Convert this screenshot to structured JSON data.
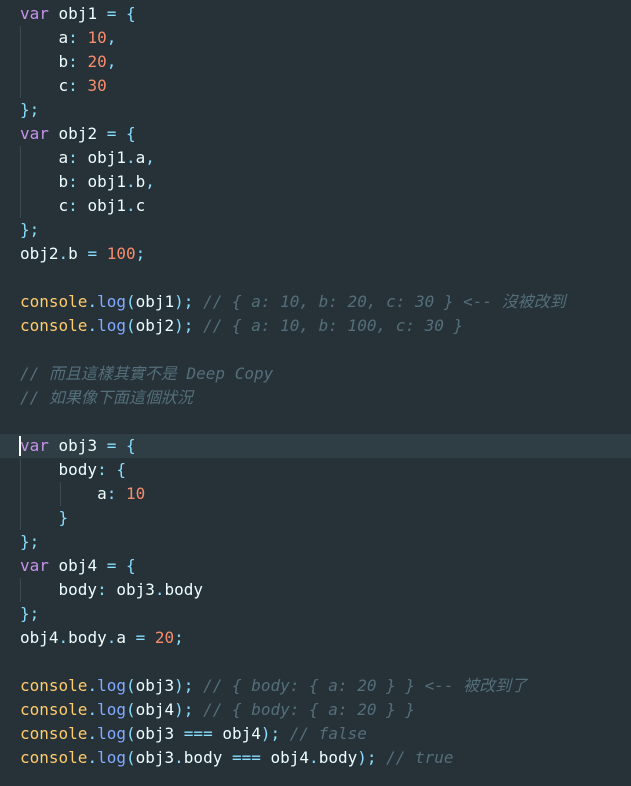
{
  "editor": {
    "colors": {
      "background": "#263238",
      "current_line": "#2f3d44",
      "keyword": "#c792ea",
      "variable": "#eeffff",
      "punctuation": "#89ddff",
      "number": "#f78c6c",
      "console": "#ffcb6b",
      "function": "#82aaff",
      "comment": "#546e7a"
    },
    "current_line": 18,
    "lines": [
      [
        [
          "kw",
          "var"
        ],
        [
          "var",
          " obj1 "
        ],
        [
          "punc",
          "="
        ],
        [
          "var",
          " "
        ],
        [
          "punc",
          "{"
        ]
      ],
      [
        [
          "var",
          "    a"
        ],
        [
          "punc",
          ":"
        ],
        [
          "var",
          " "
        ],
        [
          "num",
          "10"
        ],
        [
          "punc",
          ","
        ]
      ],
      [
        [
          "var",
          "    b"
        ],
        [
          "punc",
          ":"
        ],
        [
          "var",
          " "
        ],
        [
          "num",
          "20"
        ],
        [
          "punc",
          ","
        ]
      ],
      [
        [
          "var",
          "    c"
        ],
        [
          "punc",
          ":"
        ],
        [
          "var",
          " "
        ],
        [
          "num",
          "30"
        ]
      ],
      [
        [
          "punc",
          "};"
        ]
      ],
      [
        [
          "kw",
          "var"
        ],
        [
          "var",
          " obj2 "
        ],
        [
          "punc",
          "="
        ],
        [
          "var",
          " "
        ],
        [
          "punc",
          "{"
        ]
      ],
      [
        [
          "var",
          "    a"
        ],
        [
          "punc",
          ":"
        ],
        [
          "var",
          " obj1"
        ],
        [
          "punc",
          "."
        ],
        [
          "var",
          "a"
        ],
        [
          "punc",
          ","
        ]
      ],
      [
        [
          "var",
          "    b"
        ],
        [
          "punc",
          ":"
        ],
        [
          "var",
          " obj1"
        ],
        [
          "punc",
          "."
        ],
        [
          "var",
          "b"
        ],
        [
          "punc",
          ","
        ]
      ],
      [
        [
          "var",
          "    c"
        ],
        [
          "punc",
          ":"
        ],
        [
          "var",
          " obj1"
        ],
        [
          "punc",
          "."
        ],
        [
          "var",
          "c"
        ]
      ],
      [
        [
          "punc",
          "};"
        ]
      ],
      [
        [
          "var",
          "obj2"
        ],
        [
          "punc",
          "."
        ],
        [
          "var",
          "b "
        ],
        [
          "punc",
          "="
        ],
        [
          "var",
          " "
        ],
        [
          "num",
          "100"
        ],
        [
          "punc",
          ";"
        ]
      ],
      [],
      [
        [
          "cons",
          "console"
        ],
        [
          "punc",
          "."
        ],
        [
          "fn",
          "log"
        ],
        [
          "punc",
          "("
        ],
        [
          "var",
          "obj1"
        ],
        [
          "punc",
          ");"
        ],
        [
          "var",
          " "
        ],
        [
          "com",
          "// { a: 10, b: 20, c: 30 } <-- 沒被改到"
        ]
      ],
      [
        [
          "cons",
          "console"
        ],
        [
          "punc",
          "."
        ],
        [
          "fn",
          "log"
        ],
        [
          "punc",
          "("
        ],
        [
          "var",
          "obj2"
        ],
        [
          "punc",
          ");"
        ],
        [
          "var",
          " "
        ],
        [
          "com",
          "// { a: 10, b: 100, c: 30 }"
        ]
      ],
      [],
      [
        [
          "com",
          "// 而且這樣其實不是 Deep Copy"
        ]
      ],
      [
        [
          "com",
          "// 如果像下面這個狀況"
        ]
      ],
      [],
      [
        [
          "kw",
          "var"
        ],
        [
          "var",
          " obj3 "
        ],
        [
          "punc",
          "="
        ],
        [
          "var",
          " "
        ],
        [
          "punc",
          "{"
        ]
      ],
      [
        [
          "var",
          "    body"
        ],
        [
          "punc",
          ":"
        ],
        [
          "var",
          " "
        ],
        [
          "punc",
          "{"
        ]
      ],
      [
        [
          "var",
          "        a"
        ],
        [
          "punc",
          ":"
        ],
        [
          "var",
          " "
        ],
        [
          "num",
          "10"
        ]
      ],
      [
        [
          "var",
          "    "
        ],
        [
          "punc",
          "}"
        ]
      ],
      [
        [
          "punc",
          "};"
        ]
      ],
      [
        [
          "kw",
          "var"
        ],
        [
          "var",
          " obj4 "
        ],
        [
          "punc",
          "="
        ],
        [
          "var",
          " "
        ],
        [
          "punc",
          "{"
        ]
      ],
      [
        [
          "var",
          "    body"
        ],
        [
          "punc",
          ":"
        ],
        [
          "var",
          " obj3"
        ],
        [
          "punc",
          "."
        ],
        [
          "var",
          "body"
        ]
      ],
      [
        [
          "punc",
          "};"
        ]
      ],
      [
        [
          "var",
          "obj4"
        ],
        [
          "punc",
          "."
        ],
        [
          "var",
          "body"
        ],
        [
          "punc",
          "."
        ],
        [
          "var",
          "a "
        ],
        [
          "punc",
          "="
        ],
        [
          "var",
          " "
        ],
        [
          "num",
          "20"
        ],
        [
          "punc",
          ";"
        ]
      ],
      [],
      [
        [
          "cons",
          "console"
        ],
        [
          "punc",
          "."
        ],
        [
          "fn",
          "log"
        ],
        [
          "punc",
          "("
        ],
        [
          "var",
          "obj3"
        ],
        [
          "punc",
          ");"
        ],
        [
          "var",
          " "
        ],
        [
          "com",
          "// { body: { a: 20 } } <-- 被改到了"
        ]
      ],
      [
        [
          "cons",
          "console"
        ],
        [
          "punc",
          "."
        ],
        [
          "fn",
          "log"
        ],
        [
          "punc",
          "("
        ],
        [
          "var",
          "obj4"
        ],
        [
          "punc",
          ");"
        ],
        [
          "var",
          " "
        ],
        [
          "com",
          "// { body: { a: 20 } }"
        ]
      ],
      [
        [
          "cons",
          "console"
        ],
        [
          "punc",
          "."
        ],
        [
          "fn",
          "log"
        ],
        [
          "punc",
          "("
        ],
        [
          "var",
          "obj3 "
        ],
        [
          "punc",
          "==="
        ],
        [
          "var",
          " obj4"
        ],
        [
          "punc",
          ");"
        ],
        [
          "var",
          " "
        ],
        [
          "com",
          "// false"
        ]
      ],
      [
        [
          "cons",
          "console"
        ],
        [
          "punc",
          "."
        ],
        [
          "fn",
          "log"
        ],
        [
          "punc",
          "("
        ],
        [
          "var",
          "obj3"
        ],
        [
          "punc",
          "."
        ],
        [
          "var",
          "body "
        ],
        [
          "punc",
          "==="
        ],
        [
          "var",
          " obj4"
        ],
        [
          "punc",
          "."
        ],
        [
          "var",
          "body"
        ],
        [
          "punc",
          ");"
        ],
        [
          "var",
          " "
        ],
        [
          "com",
          "// true"
        ]
      ]
    ]
  }
}
